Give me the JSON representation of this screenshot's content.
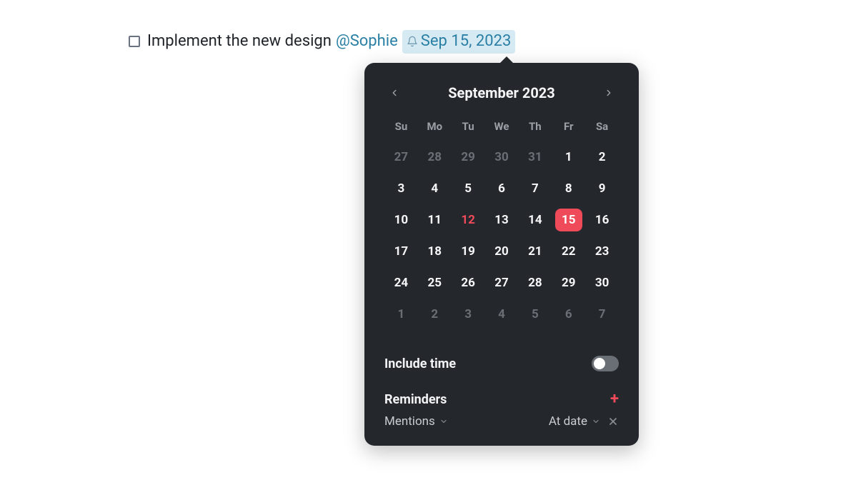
{
  "task": {
    "text": "Implement the new design",
    "mention": "@Sophie",
    "date_label": "Sep 15, 2023"
  },
  "calendar": {
    "title": "September 2023",
    "dow": [
      "Su",
      "Mo",
      "Tu",
      "We",
      "Th",
      "Fr",
      "Sa"
    ],
    "weeks": [
      [
        {
          "d": "27",
          "muted": true
        },
        {
          "d": "28",
          "muted": true
        },
        {
          "d": "29",
          "muted": true
        },
        {
          "d": "30",
          "muted": true
        },
        {
          "d": "31",
          "muted": true
        },
        {
          "d": "1"
        },
        {
          "d": "2"
        }
      ],
      [
        {
          "d": "3"
        },
        {
          "d": "4"
        },
        {
          "d": "5"
        },
        {
          "d": "6"
        },
        {
          "d": "7"
        },
        {
          "d": "8"
        },
        {
          "d": "9"
        }
      ],
      [
        {
          "d": "10"
        },
        {
          "d": "11"
        },
        {
          "d": "12",
          "today": true
        },
        {
          "d": "13"
        },
        {
          "d": "14"
        },
        {
          "d": "15",
          "selected": true
        },
        {
          "d": "16"
        }
      ],
      [
        {
          "d": "17"
        },
        {
          "d": "18"
        },
        {
          "d": "19"
        },
        {
          "d": "20"
        },
        {
          "d": "21"
        },
        {
          "d": "22"
        },
        {
          "d": "23"
        }
      ],
      [
        {
          "d": "24"
        },
        {
          "d": "25"
        },
        {
          "d": "26"
        },
        {
          "d": "27"
        },
        {
          "d": "28"
        },
        {
          "d": "29"
        },
        {
          "d": "30"
        }
      ],
      [
        {
          "d": "1",
          "muted": true
        },
        {
          "d": "2",
          "muted": true
        },
        {
          "d": "3",
          "muted": true
        },
        {
          "d": "4",
          "muted": true
        },
        {
          "d": "5",
          "muted": true
        },
        {
          "d": "6",
          "muted": true
        },
        {
          "d": "7",
          "muted": true
        }
      ]
    ]
  },
  "options": {
    "include_time_label": "Include time",
    "include_time_on": false,
    "reminders_label": "Reminders",
    "reminder_type": "Mentions",
    "reminder_when": "At date"
  }
}
